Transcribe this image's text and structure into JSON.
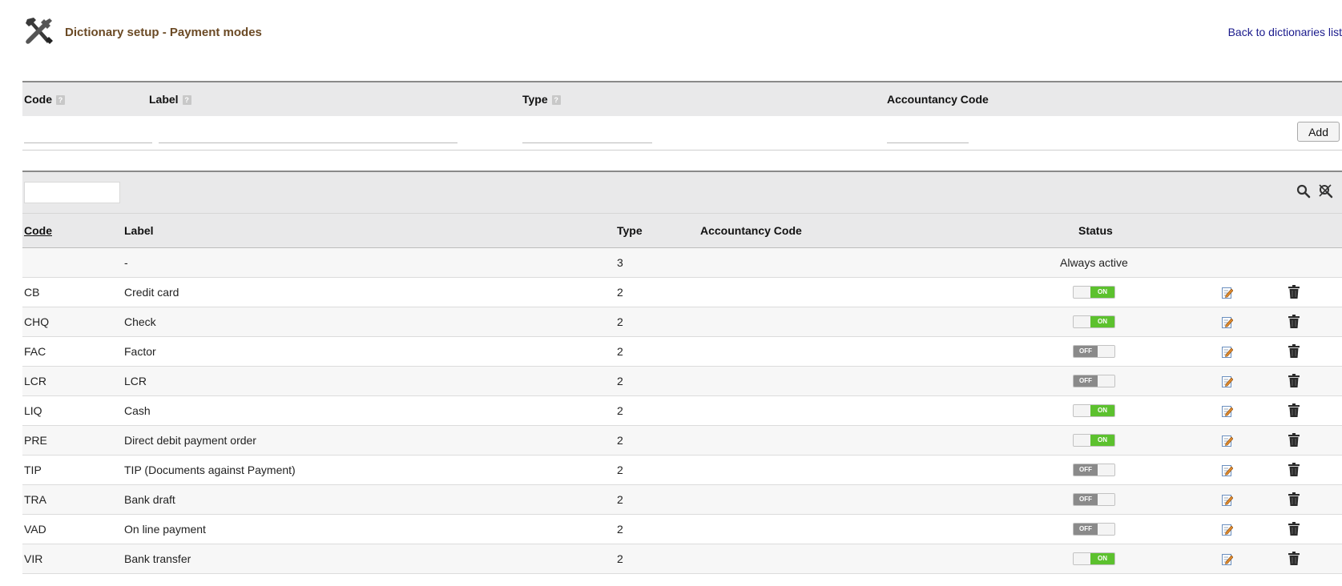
{
  "header": {
    "title": "Dictionary setup - Payment modes",
    "back_link": "Back to dictionaries list",
    "icon": "tools-icon"
  },
  "add_form": {
    "headers": {
      "code": "Code",
      "label": "Label",
      "type": "Type",
      "accountancy_code": "Accountancy Code"
    },
    "help_glyph": "?",
    "values": {
      "code": "",
      "label": "",
      "type": "",
      "accountancy_code": ""
    },
    "add_button": "Add"
  },
  "list": {
    "filter_value": "",
    "search_icon": "search-icon",
    "clear_filter_icon": "clear-filter-icon",
    "headers": {
      "code": "Code",
      "label": "Label",
      "type": "Type",
      "accountancy_code": "Accountancy Code",
      "status": "Status"
    },
    "sorted_by": "code",
    "colors": {
      "on": "#5cc12e",
      "off": "#8a8a8a"
    },
    "rows": [
      {
        "code": "",
        "label": "-",
        "type": "3",
        "accountancy_code": "",
        "status_text": "Always active"
      },
      {
        "code": "CB",
        "label": "Credit card",
        "type": "2",
        "accountancy_code": "",
        "status": "ON"
      },
      {
        "code": "CHQ",
        "label": "Check",
        "type": "2",
        "accountancy_code": "",
        "status": "ON"
      },
      {
        "code": "FAC",
        "label": "Factor",
        "type": "2",
        "accountancy_code": "",
        "status": "OFF"
      },
      {
        "code": "LCR",
        "label": "LCR",
        "type": "2",
        "accountancy_code": "",
        "status": "OFF"
      },
      {
        "code": "LIQ",
        "label": "Cash",
        "type": "2",
        "accountancy_code": "",
        "status": "ON"
      },
      {
        "code": "PRE",
        "label": "Direct debit payment order",
        "type": "2",
        "accountancy_code": "",
        "status": "ON"
      },
      {
        "code": "TIP",
        "label": "TIP (Documents against Payment)",
        "type": "2",
        "accountancy_code": "",
        "status": "OFF"
      },
      {
        "code": "TRA",
        "label": "Bank draft",
        "type": "2",
        "accountancy_code": "",
        "status": "OFF"
      },
      {
        "code": "VAD",
        "label": "On line payment",
        "type": "2",
        "accountancy_code": "",
        "status": "OFF"
      },
      {
        "code": "VIR",
        "label": "Bank transfer",
        "type": "2",
        "accountancy_code": "",
        "status": "ON"
      }
    ]
  }
}
